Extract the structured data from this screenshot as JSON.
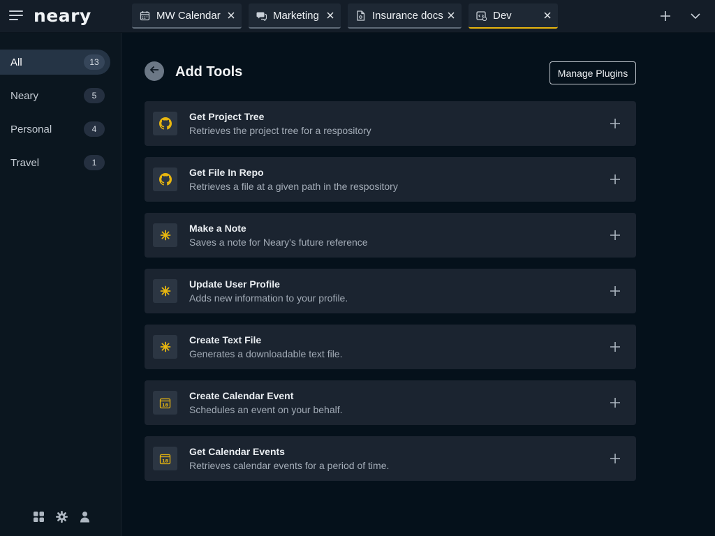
{
  "app": {
    "logo": "neary"
  },
  "tabs": [
    {
      "label": "MW Calendar",
      "icon": "calendar-icon",
      "active": false
    },
    {
      "label": "Marketing",
      "icon": "chat-icon",
      "active": false
    },
    {
      "label": "Insurance docs",
      "icon": "document-icon",
      "active": false
    },
    {
      "label": "Dev",
      "icon": "code-icon",
      "active": true
    }
  ],
  "sidebar": {
    "items": [
      {
        "label": "All",
        "count": "13",
        "active": true
      },
      {
        "label": "Neary",
        "count": "5"
      },
      {
        "label": "Personal",
        "count": "4"
      },
      {
        "label": "Travel",
        "count": "1"
      }
    ],
    "bottom_icons": [
      "apps-icon",
      "gear-icon",
      "user-icon"
    ]
  },
  "main": {
    "title": "Add Tools",
    "manage_label": "Manage Plugins",
    "tools": [
      {
        "name": "Get Project Tree",
        "desc": "Retrieves the project tree for a respository",
        "icon": "github-icon"
      },
      {
        "name": "Get File In Repo",
        "desc": "Retrieves a file at a given path in the respository",
        "icon": "github-icon"
      },
      {
        "name": "Make a Note",
        "desc": "Saves a note for Neary's future reference",
        "icon": "sparkle-icon"
      },
      {
        "name": "Update User Profile",
        "desc": "Adds new information to your profile.",
        "icon": "sparkle-icon"
      },
      {
        "name": "Create Text File",
        "desc": "Generates a downloadable text file.",
        "icon": "sparkle-icon"
      },
      {
        "name": "Create Calendar Event",
        "desc": "Schedules an event on your behalf.",
        "icon": "calendar-18-icon"
      },
      {
        "name": "Get Calendar Events",
        "desc": "Retrieves calendar events for a period of time.",
        "icon": "calendar-18-icon"
      }
    ]
  },
  "colors": {
    "accent": "#e8b60f",
    "background": "#05111b",
    "card": "#1b2430"
  }
}
